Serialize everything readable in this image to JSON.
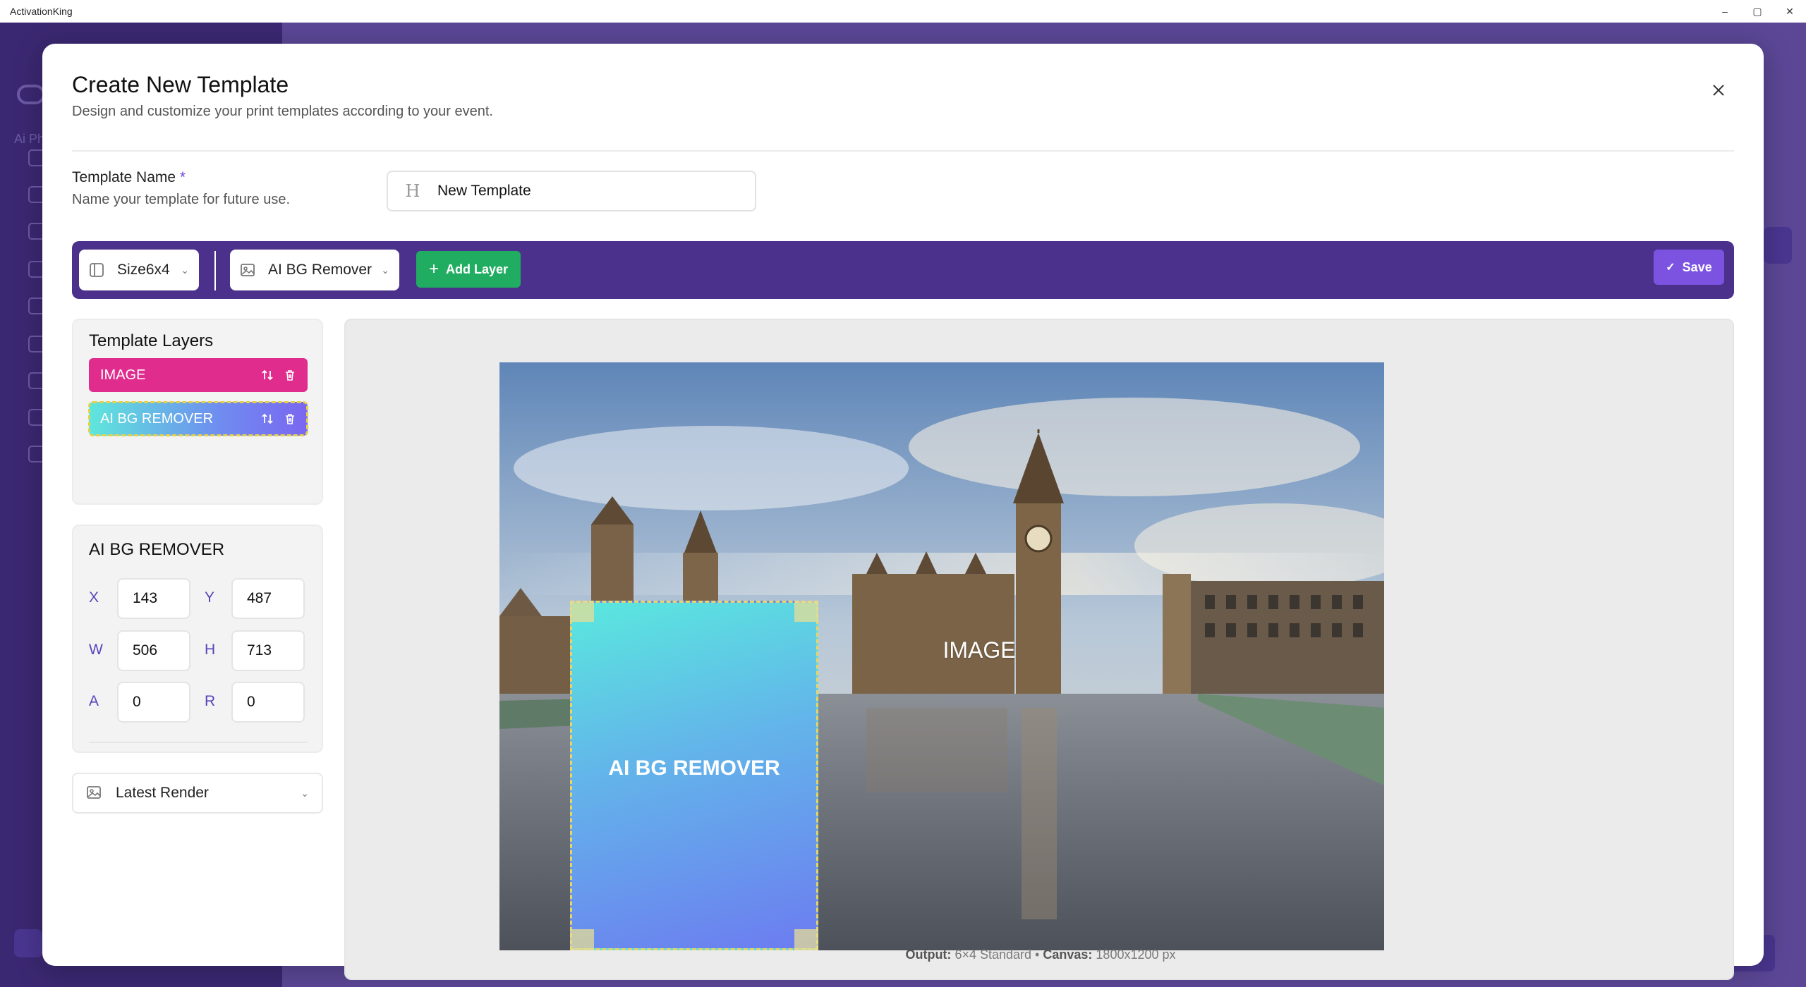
{
  "app": {
    "title": "ActivationKing"
  },
  "window_controls": {
    "minimize": "–",
    "restore": "▢",
    "close": "✕"
  },
  "background": {
    "label": "Ai Ph"
  },
  "modal": {
    "title": "Create New Template",
    "subtitle": "Design and customize your print templates according to your event.",
    "close_icon": "close-icon"
  },
  "template_name": {
    "label": "Template Name",
    "required_marker": "*",
    "description": "Name your template for future use.",
    "value": "New Template",
    "icon": "H"
  },
  "toolbar": {
    "size_select": "Size6x4",
    "layer_select": "AI BG Remover",
    "add_layer_label": "Add Layer",
    "save_label": "Save"
  },
  "layers": {
    "title": "Template Layers",
    "items": [
      {
        "label": "IMAGE",
        "color": "#e02c8d"
      },
      {
        "label": "AI BG REMOVER",
        "color": "#6f8cf0"
      }
    ]
  },
  "properties": {
    "title": "AI BG REMOVER",
    "fields": {
      "x": {
        "label": "X",
        "value": "143"
      },
      "y": {
        "label": "Y",
        "value": "487"
      },
      "w": {
        "label": "W",
        "value": "506"
      },
      "h": {
        "label": "H",
        "value": "713"
      },
      "a": {
        "label": "A",
        "value": "0"
      },
      "r": {
        "label": "R",
        "value": "0"
      }
    }
  },
  "render_select": {
    "label": "Latest Render"
  },
  "canvas": {
    "image_layer_label": "IMAGE",
    "bg_remover_label": "AI BG REMOVER",
    "footer": {
      "output_label": "Output:",
      "output_value": "6×4 Standard",
      "separator": "•",
      "canvas_label": "Canvas:",
      "canvas_value": "1800x1200 px"
    }
  },
  "colors": {
    "accent_purple": "#4b318b",
    "save": "#7c53e0",
    "add_layer": "#20ad62",
    "image_layer": "#e02c8d"
  }
}
